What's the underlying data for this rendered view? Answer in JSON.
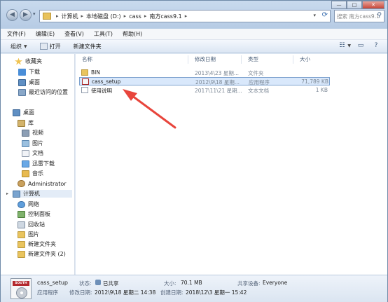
{
  "address_bar": {
    "crumbs": [
      "计算机",
      "本地磁盘 (D:)",
      "cass",
      "南方cass9.1"
    ],
    "search_placeholder": "搜索 南方cass9.1"
  },
  "menu": [
    "文件(F)",
    "编辑(E)",
    "查看(V)",
    "工具(T)",
    "帮助(H)"
  ],
  "toolbar": {
    "organize": "组织",
    "open": "打开",
    "new_folder": "新建文件夹"
  },
  "nav": {
    "favorites": "收藏夹",
    "downloads": "下载",
    "desktop_fav": "桌面",
    "recent": "最近访问的位置",
    "desktop": "桌面",
    "libraries": "库",
    "videos": "视频",
    "pictures": "图片",
    "documents": "文档",
    "thunder": "迅雷下载",
    "music": "音乐",
    "administrator": "Administrator",
    "computer": "计算机",
    "network": "网络",
    "control_panel": "控制面板",
    "recycle_bin": "回收站",
    "pictures2": "图片",
    "new_folder1": "新建文件夹",
    "new_folder2": "新建文件夹 (2)"
  },
  "columns": {
    "name": "名称",
    "modified": "修改日期",
    "type": "类型",
    "size": "大小"
  },
  "files": [
    {
      "name": "BIN",
      "modified": "2013\\4\\23 星期...",
      "type": "文件夹",
      "size": "",
      "icon": "folder-icon"
    },
    {
      "name": "cass_setup",
      "modified": "2012\\9\\18 星期...",
      "type": "应用程序",
      "size": "71,789 KB",
      "icon": "setup-icon"
    },
    {
      "name": "使用说明",
      "modified": "2017\\11\\21 星期...",
      "type": "文本文档",
      "size": "1 KB",
      "icon": "text-file-icon"
    }
  ],
  "details": {
    "name": "cass_setup",
    "type": "应用程序",
    "icon_label": "SOUTH",
    "state_label": "状态:",
    "state_value": "已共享",
    "size_label": "大小:",
    "size_value": "70.1 MB",
    "share_label": "共享设备:",
    "share_value": "Everyone",
    "modified_label": "修改日期:",
    "modified_value": "2012\\9\\18 星期二 14:38",
    "created_label": "创建日期:",
    "created_value": "2018\\12\\3 星期一 15:42"
  },
  "colors": {
    "arrow": "#e8453c",
    "selection": "#d9e8fb"
  }
}
